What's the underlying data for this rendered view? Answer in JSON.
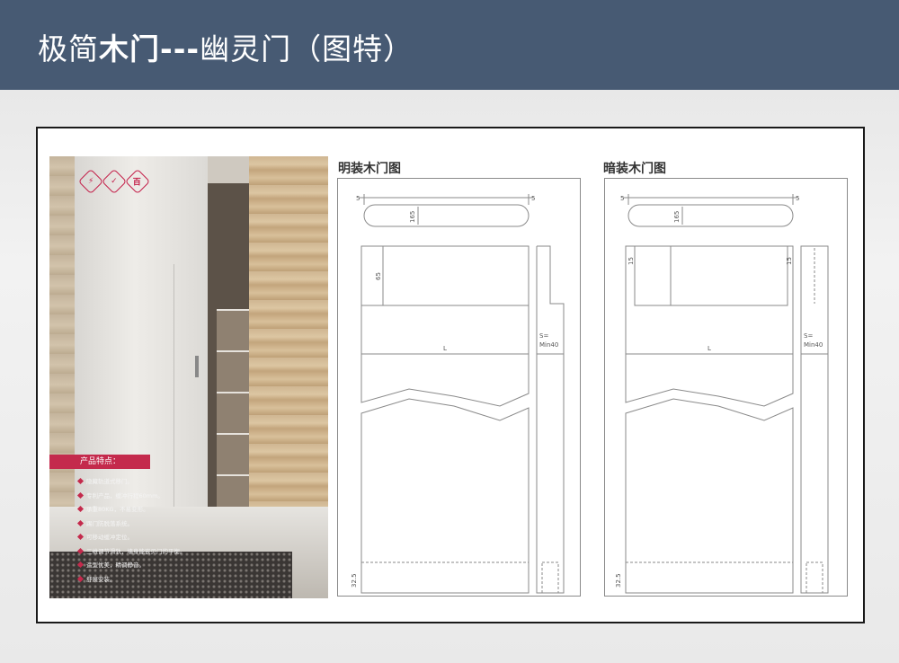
{
  "header": {
    "title_prefix": "极简",
    "title_bold": "木门---",
    "title_suffix": "幽灵门（图特）",
    "bg_color": "#475a73"
  },
  "photo": {
    "icons": [
      {
        "name": "cert-icon-1",
        "glyph": "⚡"
      },
      {
        "name": "cert-icon-2",
        "glyph": "✓"
      },
      {
        "name": "cert-icon-3",
        "glyph": "百"
      }
    ],
    "features_title": "产品特点：",
    "features": [
      "隐藏轨道式移门。",
      "专利产品，缓冲行程60mm。",
      "承重80KG，不易变形。",
      "踢门防脱落系统。",
      "可移动缓冲定位。",
      "三维调节滑轨，墙身能嵌贝门的平衡。",
      "造型优美，精调静音。",
      "舒展安装。"
    ],
    "accent_color": "#c42a4c"
  },
  "drawings": [
    {
      "title": "明装木门图",
      "handle_margin_left": "5",
      "handle_margin_right": "5",
      "handle_height": "165",
      "top_height": "65",
      "width_label": "L",
      "wall_label": "S=",
      "wall_min": "Min40",
      "bottom_height": "32.5"
    },
    {
      "title": "暗装木门图",
      "handle_margin_left": "5",
      "handle_margin_right": "5",
      "handle_height": "165",
      "top_left_dim": "15",
      "top_right_dim": "15",
      "width_label": "L",
      "wall_label": "S=",
      "wall_min": "Min40",
      "bottom_height": "32.5"
    }
  ]
}
